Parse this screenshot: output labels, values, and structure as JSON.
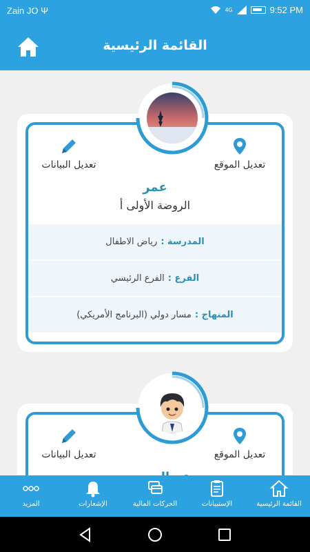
{
  "status_bar": {
    "carrier": "Zain JO",
    "usb_glyph": "Ψ",
    "network": "4G",
    "time": "9:52 PM"
  },
  "header": {
    "title": "القائمة الرئيسية"
  },
  "actions": {
    "edit_location": "تعديل الموقع",
    "edit_data": "تعديل البيانات"
  },
  "students": [
    {
      "name": "عمر",
      "class": "الروضة الأولى أ",
      "rows": [
        {
          "label": "المدرسة :",
          "value": "رياض الاطفال"
        },
        {
          "label": "الفرع :",
          "value": "الفرع الرئيسي"
        },
        {
          "label": "المنهاج :",
          "value": "مسار دولي (البرنامج الأمريكي)"
        }
      ]
    },
    {
      "name": "عبدالمحسن"
    }
  ],
  "bottom_nav": [
    {
      "label": "القائمة الرئيسية",
      "icon": "home-icon"
    },
    {
      "label": "الإستبيانات",
      "icon": "survey-icon"
    },
    {
      "label": "الحركات المالية",
      "icon": "payments-icon"
    },
    {
      "label": "الإشعارات",
      "icon": "bell-icon"
    },
    {
      "label": "المزيد",
      "icon": "more-icon"
    }
  ],
  "colors": {
    "primary": "#2da2e0",
    "card_border": "#2e9ad6",
    "accent_text": "#2e8fb3",
    "row_bg": "#eef5fb"
  }
}
